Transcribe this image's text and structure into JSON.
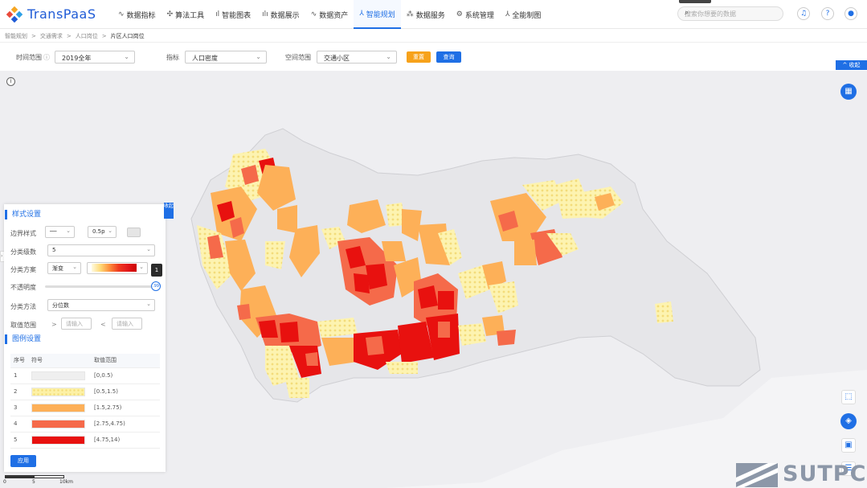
{
  "app": {
    "logo_text": "TransPaaS"
  },
  "nav": [
    {
      "label": "数据指标",
      "icon": "chart-line-icon",
      "glyph": "∿"
    },
    {
      "label": "算法工具",
      "icon": "tools-icon",
      "glyph": "✣"
    },
    {
      "label": "智能图表",
      "icon": "bar-chart-icon",
      "glyph": "ıl"
    },
    {
      "label": "数据展示",
      "icon": "bar-chart-icon",
      "glyph": "ılı"
    },
    {
      "label": "数据资产",
      "icon": "asset-icon",
      "glyph": "∿"
    },
    {
      "label": "智能规划",
      "icon": "planning-icon",
      "glyph": "⅄",
      "active": true
    },
    {
      "label": "数据服务",
      "icon": "service-icon",
      "glyph": "⁂"
    },
    {
      "label": "系统管理",
      "icon": "gear-icon",
      "glyph": "⚙"
    },
    {
      "label": "全能制图",
      "icon": "drawing-icon",
      "glyph": "⅄"
    }
  ],
  "search": {
    "placeholder": "搜索你想要的数据"
  },
  "breadcrumb": [
    "智能规划",
    "交通需求",
    "人口岗位",
    "片区人口岗位"
  ],
  "filters": {
    "time_label": "时间范围",
    "time_value": "2019全年",
    "indicator_label": "指标",
    "indicator_value": "人口密度",
    "space_label": "空间范围",
    "space_value": "交通小区",
    "reset_label": "重置",
    "query_label": "查询"
  },
  "collapse_top_label": "收起",
  "panel": {
    "fold_label": "收起",
    "style_title": "样式设置",
    "border_style_label": "边界样式",
    "border_width_value": "0.5p",
    "class_count_label": "分类级数",
    "class_count_value": "5",
    "scheme_label": "分类方案",
    "scheme_value": "渐变",
    "opacity_label": "不透明度",
    "opacity_value": 1,
    "opacity_tip": "1",
    "opacity_knob": ".99",
    "method_label": "分类方法",
    "method_value": "分位数",
    "range_label": "取值范围",
    "range_gt": ">",
    "range_lt": "<",
    "range_placeholder": "请输入",
    "legend_title": "图例设置",
    "legend_headers": [
      "序号",
      "符号",
      "取值范围"
    ],
    "legend_rows": [
      {
        "index": "1",
        "color": "#efefef",
        "range": "[0,0.5)"
      },
      {
        "index": "2",
        "color": "#fdf1a6",
        "range": "[0.5,1.5)"
      },
      {
        "index": "3",
        "color": "#fdb058",
        "range": "[1.5,2.75)"
      },
      {
        "index": "4",
        "color": "#f56a4a",
        "range": "[2.75,4.75)"
      },
      {
        "index": "5",
        "color": "#e8110f",
        "range": "[4.75,14)"
      }
    ],
    "apply_label": "应用"
  },
  "scalebar": {
    "labels": [
      "0",
      "5",
      "10km"
    ]
  },
  "watermark": {
    "text": "SUTPC"
  }
}
